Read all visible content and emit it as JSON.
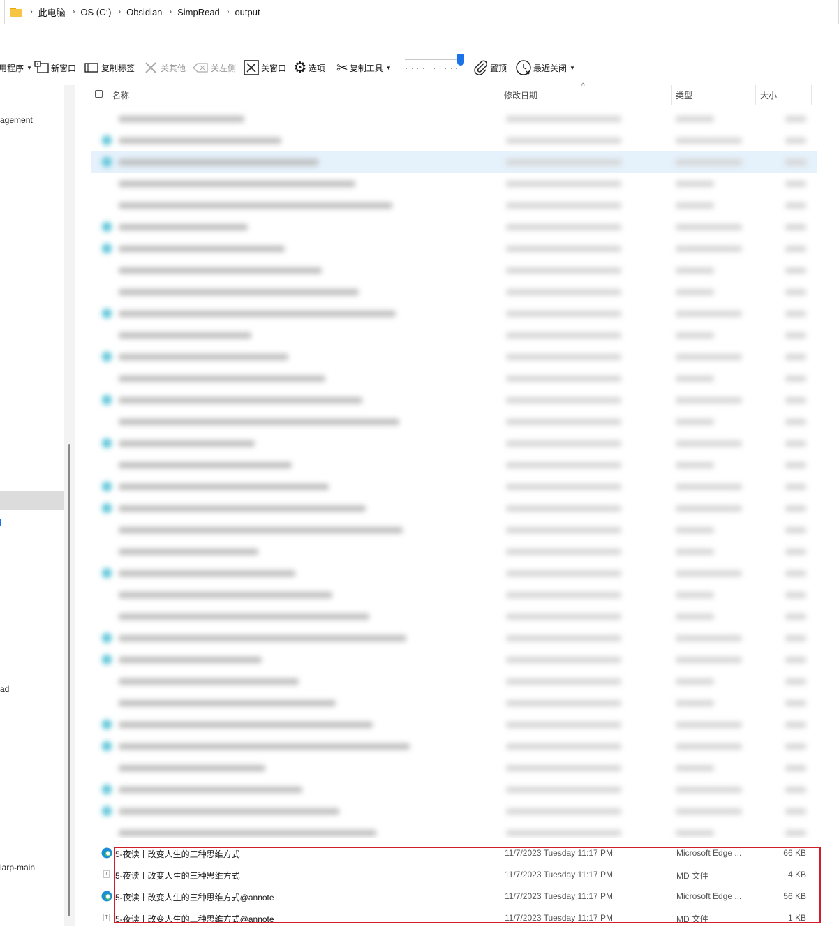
{
  "breadcrumb": {
    "items": [
      "此电脑",
      "OS (C:)",
      "Obsidian",
      "SimpRead",
      "output"
    ]
  },
  "toolbar": {
    "items": [
      {
        "label": "用程序",
        "icon": "app-icon",
        "disabled": false,
        "dropdown": true
      },
      {
        "label": "新窗口",
        "icon": "new-window-icon",
        "disabled": false
      },
      {
        "label": "复制标签",
        "icon": "copy-tab-icon",
        "disabled": false
      },
      {
        "label": "关其他",
        "icon": "close-others-icon",
        "disabled": true
      },
      {
        "label": "关左侧",
        "icon": "close-left-icon",
        "disabled": true
      },
      {
        "label": "关窗口",
        "icon": "close-window-icon",
        "disabled": false
      },
      {
        "label": "选项",
        "icon": "gear-icon",
        "disabled": false
      },
      {
        "label": "复制工具",
        "icon": "scissors-icon",
        "disabled": false,
        "dropdown": true
      },
      {
        "label": "置顶",
        "icon": "paperclip-icon",
        "disabled": false
      },
      {
        "label": "最近关闭",
        "icon": "recent-close-icon",
        "disabled": false,
        "dropdown": true
      }
    ]
  },
  "nav": {
    "items": [
      "agement",
      "ad",
      "larp-main"
    ]
  },
  "columns": {
    "name": "名称",
    "modified": "修改日期",
    "type": "类型",
    "size": "大小"
  },
  "files": [
    {
      "name": "5-夜读丨改变人生的三种思维方式",
      "modified": "11/7/2023 Tuesday 11:17 PM",
      "type": "Microsoft Edge ...",
      "size": "66 KB",
      "icon": "edge-icon"
    },
    {
      "name": "5-夜读丨改变人生的三种思维方式",
      "modified": "11/7/2023 Tuesday 11:17 PM",
      "type": "MD 文件",
      "size": "4 KB",
      "icon": "md-file-icon"
    },
    {
      "name": "5-夜读丨改变人生的三种思维方式@annote",
      "modified": "11/7/2023 Tuesday 11:17 PM",
      "type": "Microsoft Edge ...",
      "size": "56 KB",
      "icon": "edge-icon"
    },
    {
      "name": "5-夜读丨改变人生的三种思维方式@annote",
      "modified": "11/7/2023 Tuesday 11:17 PM",
      "type": "MD 文件",
      "size": "1 KB",
      "icon": "md-file-icon"
    }
  ],
  "colors": {
    "accent": "#1a73e8",
    "highlight_box": "#d11f2a",
    "selection": "#e5f1fb",
    "folder": "#f7c443"
  }
}
